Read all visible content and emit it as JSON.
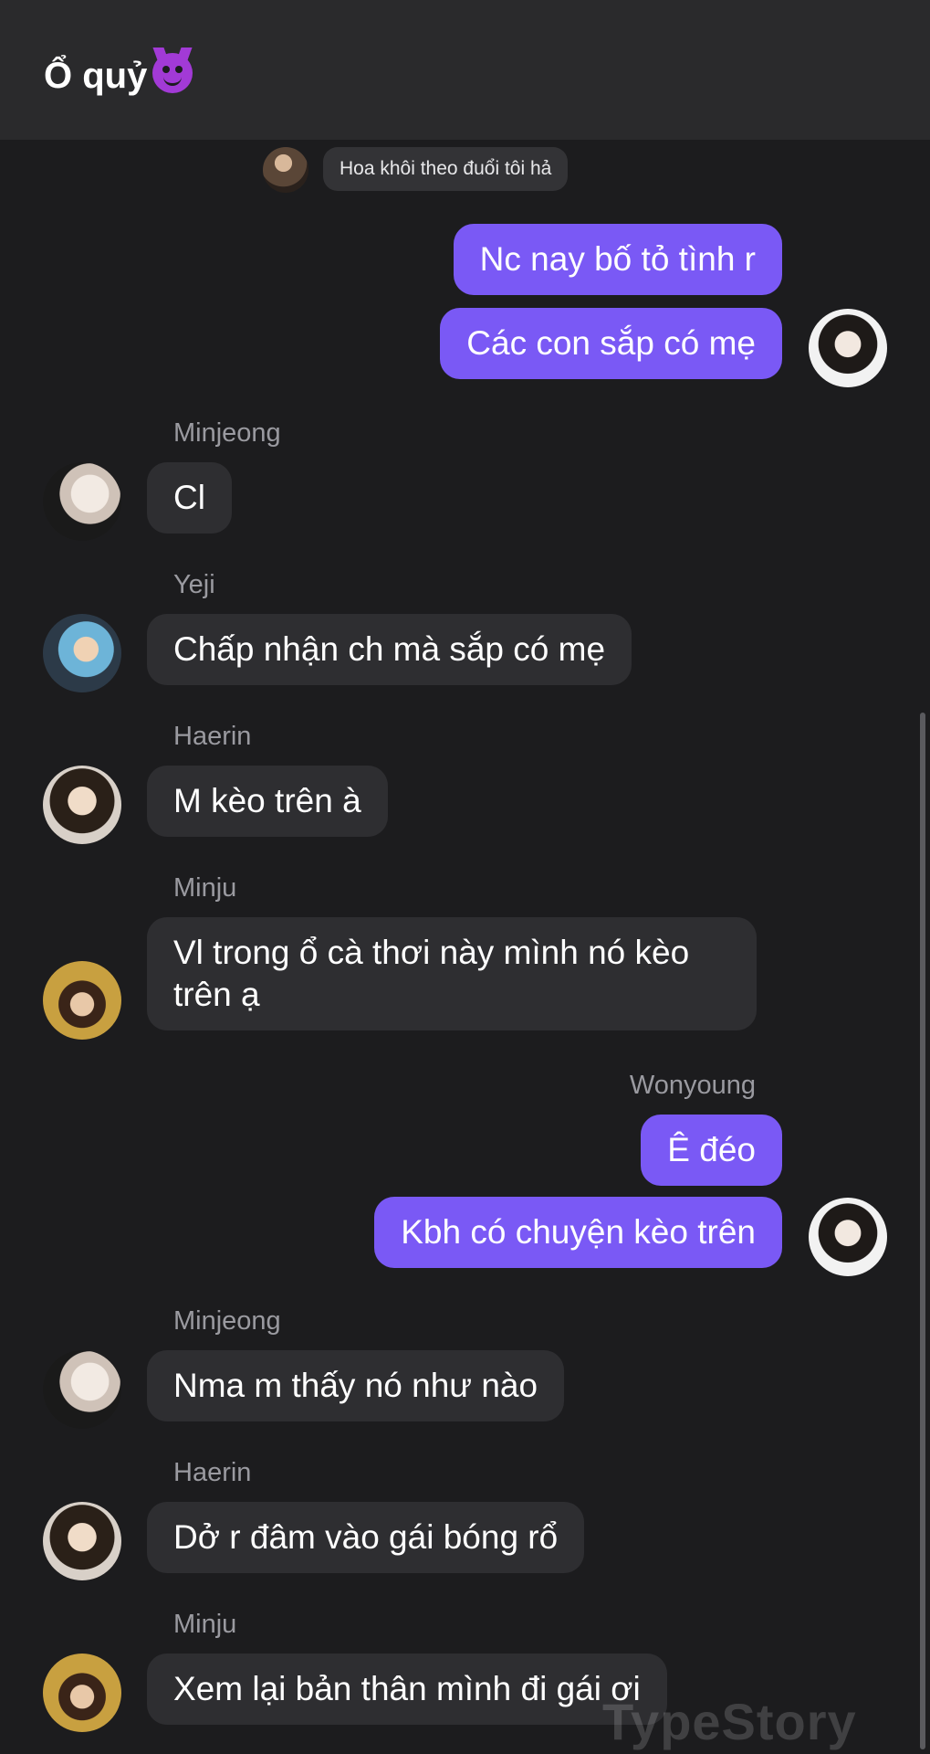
{
  "header": {
    "title": "Ổ quỷ",
    "emoji": "smiling-face-with-horns"
  },
  "reply_preview": {
    "text": "Hoa khôi theo đuổi tôi hả"
  },
  "messages": [
    {
      "sender": "Wonyoung",
      "direction": "out",
      "text": "Nc nay bố tỏ tình r"
    },
    {
      "sender": "Wonyoung",
      "direction": "out",
      "text": "Các con sắp có mẹ"
    },
    {
      "sender": "Minjeong",
      "direction": "in",
      "text": "Cl"
    },
    {
      "sender": "Yeji",
      "direction": "in",
      "text": "Chấp nhận ch mà sắp có mẹ"
    },
    {
      "sender": "Haerin",
      "direction": "in",
      "text": "M kèo trên à"
    },
    {
      "sender": "Minju",
      "direction": "in",
      "text": "Vl trong ổ cà thơi này mình nó kèo trên ạ"
    },
    {
      "sender": "Wonyoung",
      "direction": "out",
      "text": "Ê đéo"
    },
    {
      "sender": "Wonyoung",
      "direction": "out",
      "text": "Kbh có chuyện kèo trên"
    },
    {
      "sender": "Minjeong",
      "direction": "in",
      "text": "Nma m thấy nó như nào"
    },
    {
      "sender": "Haerin",
      "direction": "in",
      "text": "Dở r đâm vào gái bóng rổ"
    },
    {
      "sender": "Minju",
      "direction": "in",
      "text": "Xem lại bản thân mình đi gái ơi"
    }
  ],
  "watermark": "TypeStory",
  "colors": {
    "outgoing_bubble": "#7a59f5",
    "incoming_bubble": "#2e2e31",
    "background": "#1c1c1e"
  }
}
